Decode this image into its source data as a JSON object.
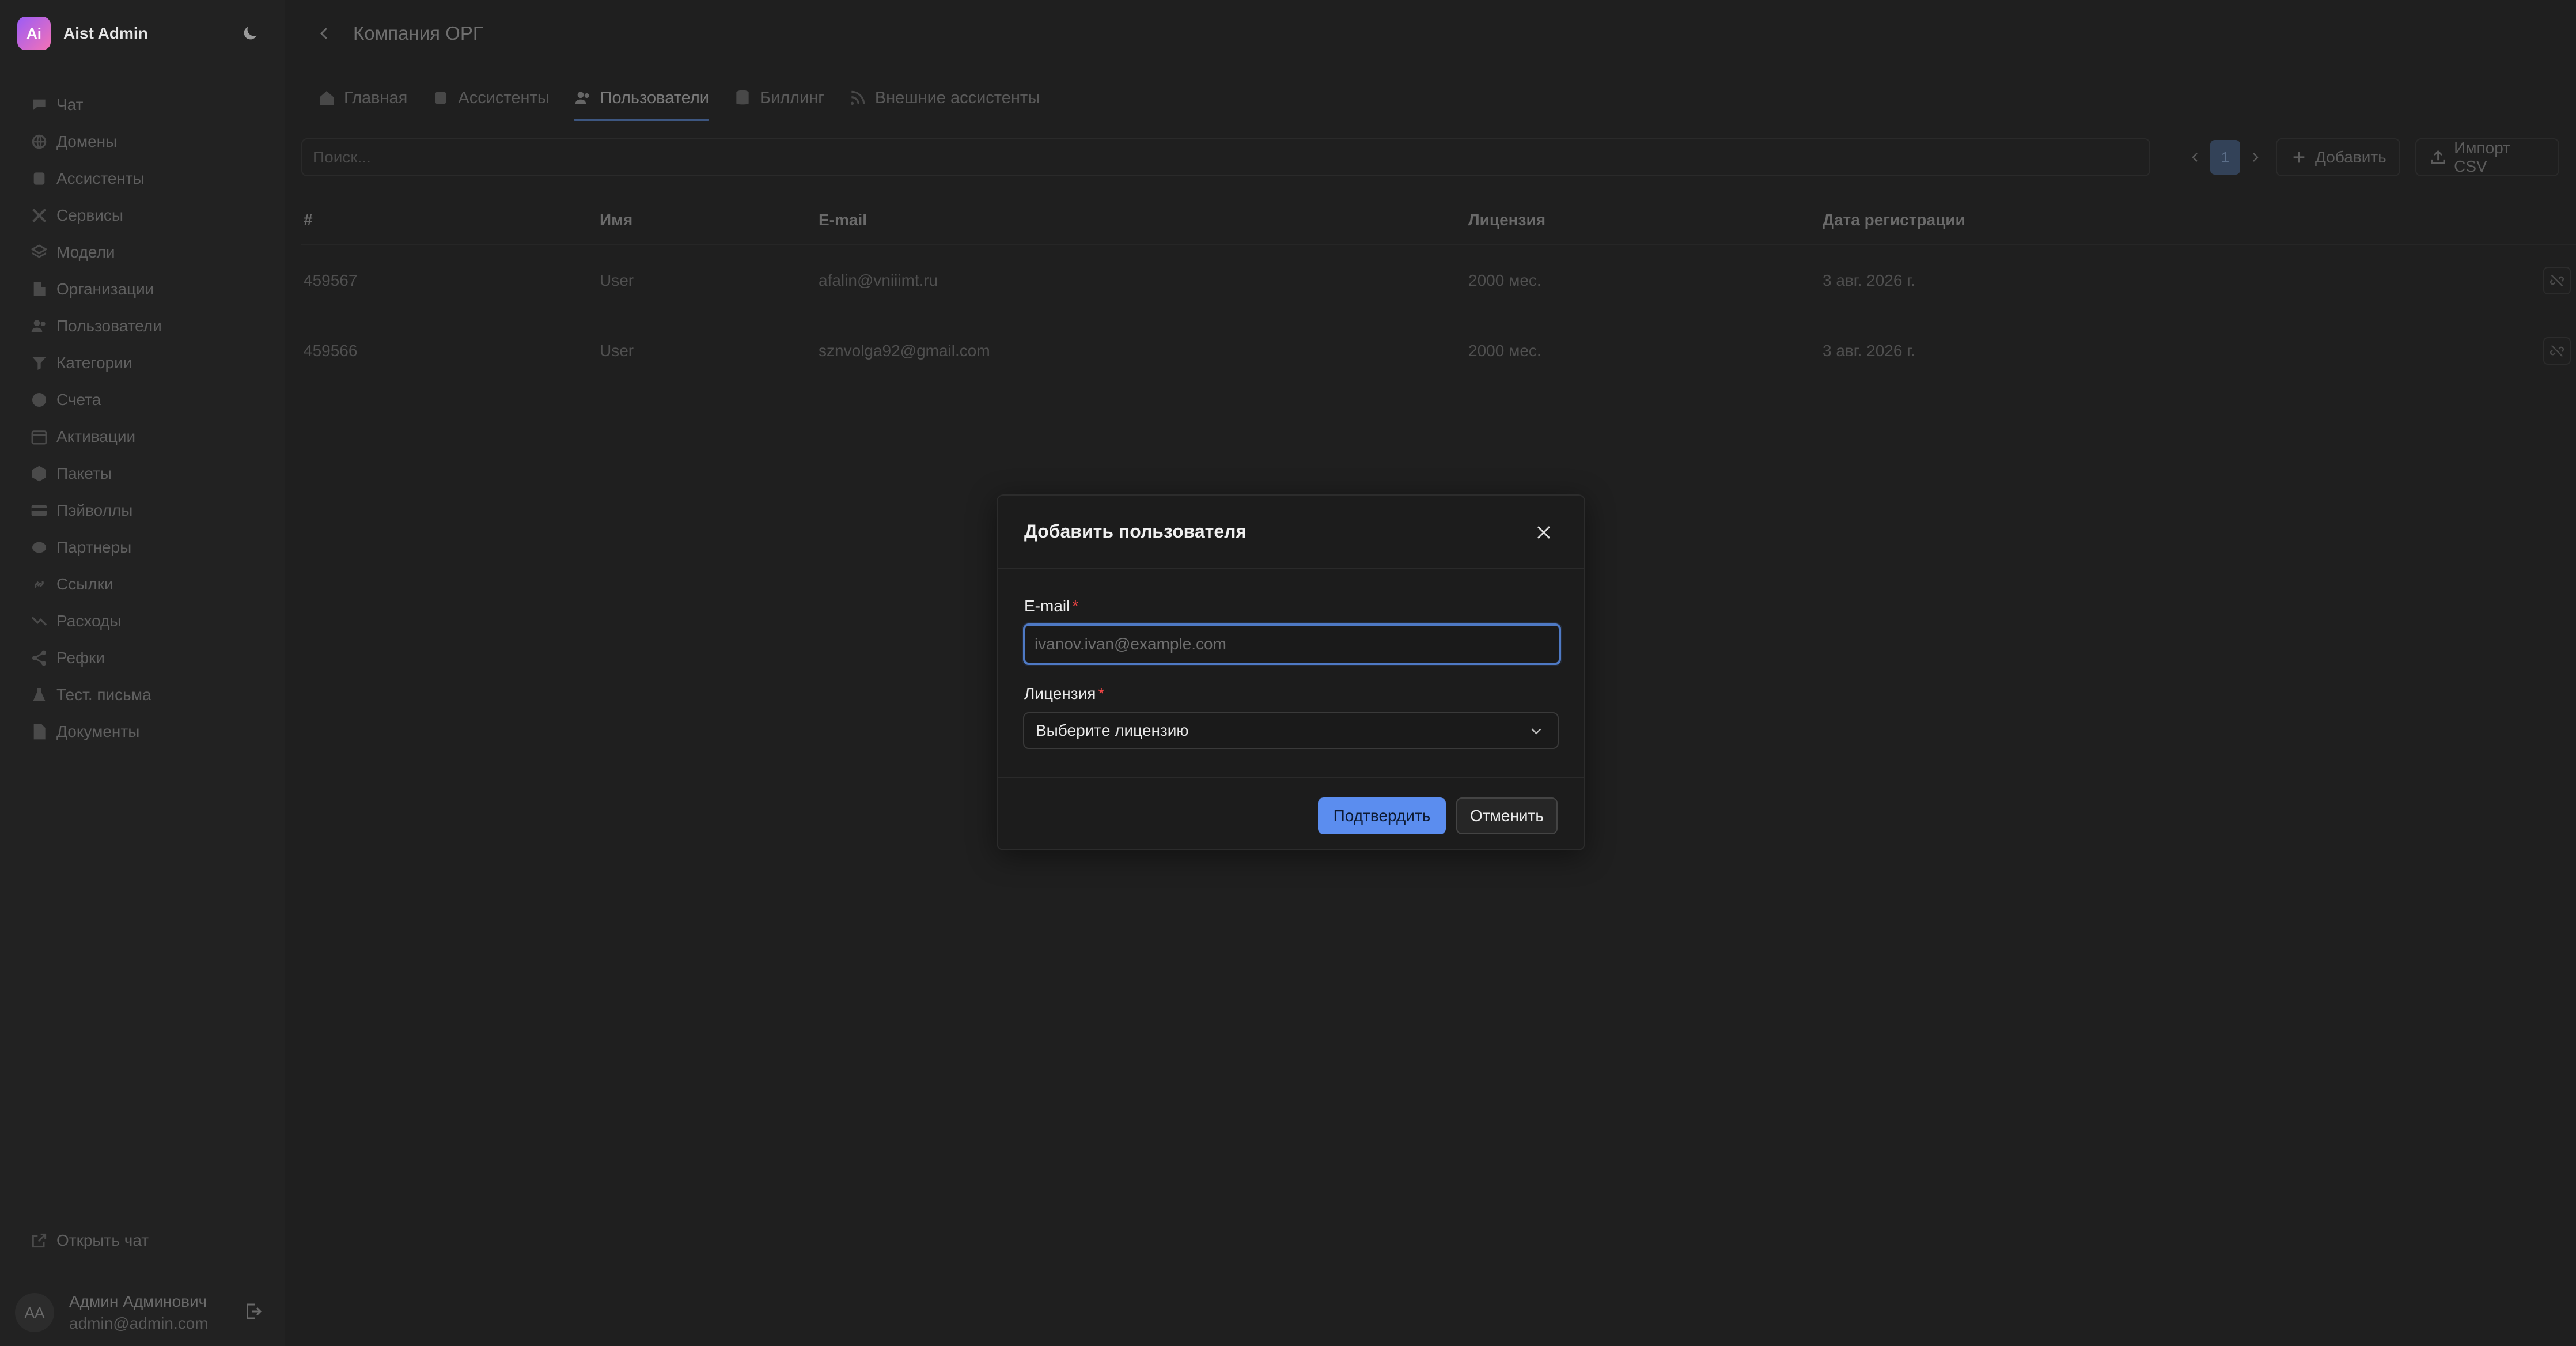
{
  "brand": {
    "logo_text": "Ai",
    "name": "Aist Admin"
  },
  "sidebar": {
    "items": [
      {
        "label": "Чат",
        "icon": "chat-icon"
      },
      {
        "label": "Домены",
        "icon": "globe-icon"
      },
      {
        "label": "Ассистенты",
        "icon": "assistant-icon"
      },
      {
        "label": "Сервисы",
        "icon": "tools-icon"
      },
      {
        "label": "Модели",
        "icon": "layers-icon"
      },
      {
        "label": "Организации",
        "icon": "building-icon"
      },
      {
        "label": "Пользователи",
        "icon": "users-icon"
      },
      {
        "label": "Категории",
        "icon": "filter-icon"
      },
      {
        "label": "Счета",
        "icon": "dollar-icon"
      },
      {
        "label": "Активации",
        "icon": "calendar-icon"
      },
      {
        "label": "Пакеты",
        "icon": "package-icon"
      },
      {
        "label": "Пэйволлы",
        "icon": "card-icon"
      },
      {
        "label": "Партнеры",
        "icon": "handshake-icon"
      },
      {
        "label": "Ссылки",
        "icon": "link-icon"
      },
      {
        "label": "Расходы",
        "icon": "trend-down-icon"
      },
      {
        "label": "Рефки",
        "icon": "share-icon"
      },
      {
        "label": "Тест. письма",
        "icon": "flask-icon"
      },
      {
        "label": "Документы",
        "icon": "document-icon"
      }
    ],
    "open_chat": "Открыть чат",
    "user": {
      "initials": "AA",
      "name": "Админ Админович",
      "email": "admin@admin.com"
    }
  },
  "header": {
    "title": "Компания ОРГ"
  },
  "tabs": [
    {
      "label": "Главная",
      "icon": "home-icon"
    },
    {
      "label": "Ассистенты",
      "icon": "assistant-icon"
    },
    {
      "label": "Пользователи",
      "icon": "users-icon",
      "active": true
    },
    {
      "label": "Биллинг",
      "icon": "database-icon"
    },
    {
      "label": "Внешние ассистенты",
      "icon": "rss-icon"
    }
  ],
  "toolbar": {
    "search_placeholder": "Поиск...",
    "current_page": "1",
    "add_label": "Добавить",
    "import_label": "Импорт CSV"
  },
  "table": {
    "columns": [
      "#",
      "Имя",
      "E-mail",
      "Лицензия",
      "Дата регистрации"
    ],
    "rows": [
      [
        "459567",
        "User",
        "afalin@vniiimt.ru",
        "2000 мес.",
        "3 авг. 2026 г."
      ],
      [
        "459566",
        "User",
        "sznvolga92@gmail.com",
        "2000 мес.",
        "3 авг. 2026 г."
      ]
    ]
  },
  "modal": {
    "title": "Добавить пользователя",
    "email_label": "E-mail",
    "email_placeholder": "ivanov.ivan@example.com",
    "license_label": "Лицензия",
    "license_placeholder": "Выберите лицензию",
    "required_mark": "*",
    "confirm_label": "Подтвердить",
    "cancel_label": "Отменить"
  },
  "colors": {
    "accent": "#5b8def",
    "required": "#ef4444",
    "background": "#1f1f1f"
  }
}
